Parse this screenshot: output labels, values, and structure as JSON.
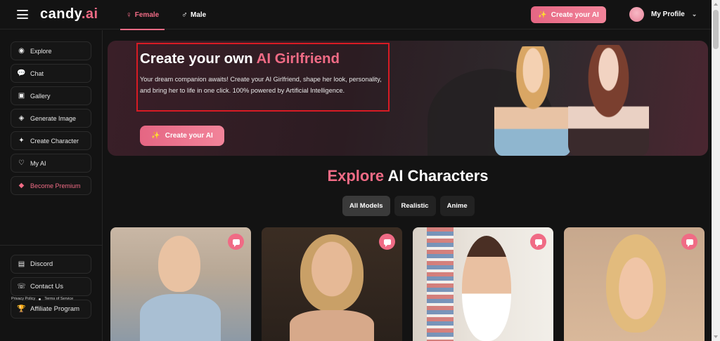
{
  "brand": {
    "name": "candy",
    "suffix": ".ai"
  },
  "header": {
    "tabs": [
      {
        "label": "Female",
        "icon": "female-icon",
        "active": true
      },
      {
        "label": "Male",
        "icon": "male-icon",
        "active": false
      }
    ],
    "create_button": "Create your AI",
    "profile_label": "My Profile"
  },
  "sidebar": {
    "items": [
      {
        "label": "Explore",
        "icon": "compass-icon"
      },
      {
        "label": "Chat",
        "icon": "chat-icon"
      },
      {
        "label": "Gallery",
        "icon": "gallery-icon"
      },
      {
        "label": "Generate Image",
        "icon": "generate-image-icon"
      },
      {
        "label": "Create Character",
        "icon": "magic-wand-icon"
      },
      {
        "label": "My AI",
        "icon": "heart-icon"
      },
      {
        "label": "Become Premium",
        "icon": "diamond-icon"
      }
    ],
    "footer_items": [
      {
        "label": "Discord",
        "icon": "discord-icon"
      },
      {
        "label": "Contact Us",
        "icon": "contact-icon"
      },
      {
        "label": "Affiliate Program",
        "icon": "trophy-icon"
      }
    ],
    "legal": {
      "privacy": "Privacy Policy",
      "terms": "Terms of Service"
    }
  },
  "hero": {
    "title_prefix": "Create your own ",
    "title_accent": "AI Girlfriend",
    "description": "Your dream companion awaits! Create your AI Girlfriend, shape her look, personality, and bring her to life in one click. 100% powered by Artificial Intelligence.",
    "button": "Create your AI"
  },
  "explore": {
    "title_accent": "Explore",
    "title_rest": " AI Characters",
    "filters": [
      "All Models",
      "Realistic",
      "Anime"
    ],
    "active_filter": "All Models"
  },
  "colors": {
    "accent": "#f06b85",
    "background": "#131313",
    "highlight_box": "#d81b24"
  }
}
